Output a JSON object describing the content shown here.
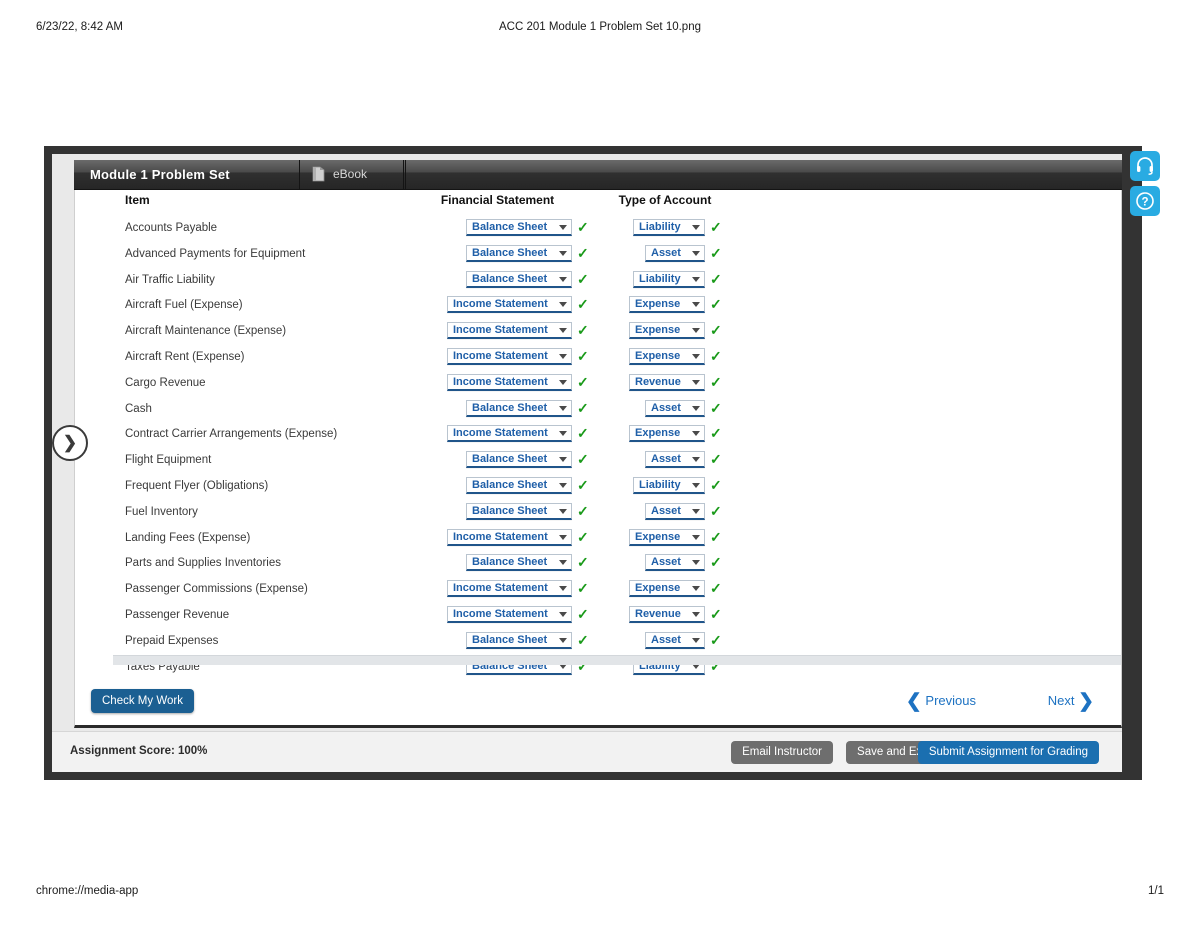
{
  "print": {
    "left_header": "6/23/22, 8:42 AM",
    "center_header": "ACC 201 Module 1 Problem Set 10.png",
    "left_footer": "chrome://media-app",
    "right_footer": "1/1"
  },
  "window": {
    "title": "Module 1 Problem Set",
    "tab_ebook_label": "eBook"
  },
  "table": {
    "headers": {
      "item": "Item",
      "financial_statement": "Financial Statement",
      "type_of_account": "Type of Account"
    },
    "rows": [
      {
        "item": "Accounts Payable",
        "financial_statement": "Balance Sheet",
        "type_of_account": "Liability",
        "fs_correct": "✓",
        "ta_correct": "✓"
      },
      {
        "item": "Advanced Payments for Equipment",
        "financial_statement": "Balance Sheet",
        "type_of_account": "Asset",
        "fs_correct": "✓",
        "ta_correct": "✓"
      },
      {
        "item": "Air Traffic Liability",
        "financial_statement": "Balance Sheet",
        "type_of_account": "Liability",
        "fs_correct": "✓",
        "ta_correct": "✓"
      },
      {
        "item": "Aircraft Fuel (Expense)",
        "financial_statement": "Income Statement",
        "type_of_account": "Expense",
        "fs_correct": "✓",
        "ta_correct": "✓"
      },
      {
        "item": "Aircraft Maintenance (Expense)",
        "financial_statement": "Income Statement",
        "type_of_account": "Expense",
        "fs_correct": "✓",
        "ta_correct": "✓"
      },
      {
        "item": "Aircraft Rent (Expense)",
        "financial_statement": "Income Statement",
        "type_of_account": "Expense",
        "fs_correct": "✓",
        "ta_correct": "✓"
      },
      {
        "item": "Cargo Revenue",
        "financial_statement": "Income Statement",
        "type_of_account": "Revenue",
        "fs_correct": "✓",
        "ta_correct": "✓"
      },
      {
        "item": "Cash",
        "financial_statement": "Balance Sheet",
        "type_of_account": "Asset",
        "fs_correct": "✓",
        "ta_correct": "✓"
      },
      {
        "item": "Contract Carrier Arrangements (Expense)",
        "financial_statement": "Income Statement",
        "type_of_account": "Expense",
        "fs_correct": "✓",
        "ta_correct": "✓"
      },
      {
        "item": "Flight Equipment",
        "financial_statement": "Balance Sheet",
        "type_of_account": "Asset",
        "fs_correct": "✓",
        "ta_correct": "✓"
      },
      {
        "item": "Frequent Flyer (Obligations)",
        "financial_statement": "Balance Sheet",
        "type_of_account": "Liability",
        "fs_correct": "✓",
        "ta_correct": "✓"
      },
      {
        "item": "Fuel Inventory",
        "financial_statement": "Balance Sheet",
        "type_of_account": "Asset",
        "fs_correct": "✓",
        "ta_correct": "✓"
      },
      {
        "item": "Landing Fees (Expense)",
        "financial_statement": "Income Statement",
        "type_of_account": "Expense",
        "fs_correct": "✓",
        "ta_correct": "✓"
      },
      {
        "item": "Parts and Supplies Inventories",
        "financial_statement": "Balance Sheet",
        "type_of_account": "Asset",
        "fs_correct": "✓",
        "ta_correct": "✓"
      },
      {
        "item": "Passenger Commissions (Expense)",
        "financial_statement": "Income Statement",
        "type_of_account": "Expense",
        "fs_correct": "✓",
        "ta_correct": "✓"
      },
      {
        "item": "Passenger Revenue",
        "financial_statement": "Income Statement",
        "type_of_account": "Revenue",
        "fs_correct": "✓",
        "ta_correct": "✓"
      },
      {
        "item": "Prepaid Expenses",
        "financial_statement": "Balance Sheet",
        "type_of_account": "Asset",
        "fs_correct": "✓",
        "ta_correct": "✓"
      },
      {
        "item": "Taxes Payable",
        "financial_statement": "Balance Sheet",
        "type_of_account": "Liability",
        "fs_correct": "✓",
        "ta_correct": "✓"
      }
    ],
    "financial_statement_options": [
      "Balance Sheet",
      "Income Statement"
    ],
    "type_of_account_options": [
      "Asset",
      "Liability",
      "Revenue",
      "Expense"
    ]
  },
  "actions": {
    "check_my_work": "Check My Work",
    "previous": "Previous",
    "next": "Next",
    "prev_chevron": "❮",
    "next_chevron": "❯"
  },
  "status": {
    "score_label": "Assignment Score:  100%",
    "email_instructor": "Email Instructor",
    "save_and_exit": "Save and Exit",
    "submit_assignment": "Submit Assignment for Grading"
  },
  "side_icons": {
    "support": "headset-icon",
    "help": "question-mark-icon"
  },
  "colors": {
    "accent_blue": "#1b6fb0",
    "link_blue": "#1f5fa8",
    "check_green": "#1a9a1a",
    "icon_cyan": "#29abe2",
    "bezel_dark": "#333333"
  }
}
